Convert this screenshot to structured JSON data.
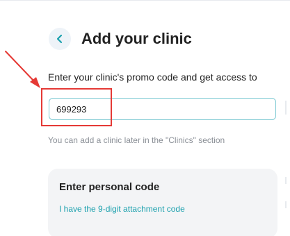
{
  "header": {
    "title": "Add your clinic",
    "back_icon": "chevron-left-icon"
  },
  "promo": {
    "description": "Enter your clinic's promo code and get access to",
    "code_value": "699293",
    "hint": "You can add a clinic later in the \"Clinics\" section"
  },
  "personal_code_card": {
    "title": "Enter personal code",
    "link": "I have the 9-digit attachment code"
  },
  "annotation": {
    "color": "#e53935"
  },
  "colors": {
    "accent": "#1aa0ad",
    "input_border": "#7fcad3",
    "card_background": "#f3f4f6"
  }
}
